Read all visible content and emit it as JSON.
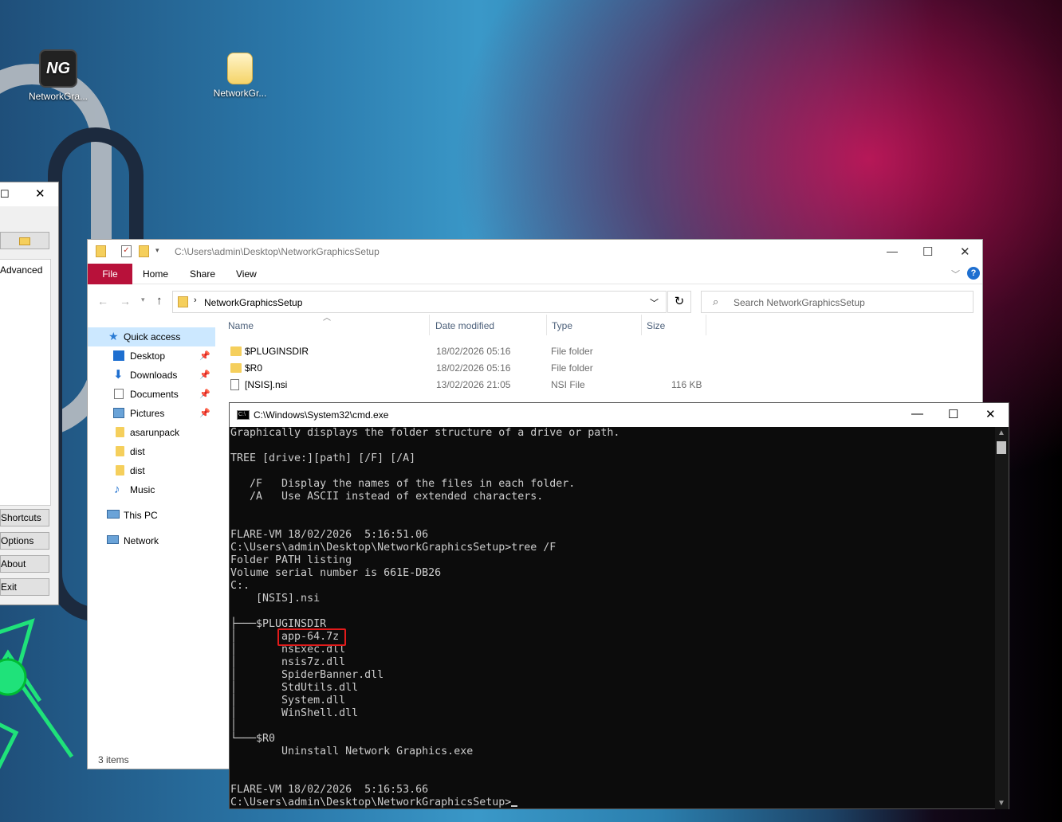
{
  "desktop": {
    "icons": [
      {
        "label": "NetworkGra...",
        "glyph": "NG"
      },
      {
        "label": "NetworkGr..."
      }
    ]
  },
  "left_window": {
    "tab_label": "Advanced",
    "buttons": [
      "Shortcuts",
      "Options",
      "About",
      "Exit"
    ]
  },
  "explorer": {
    "title_path": "C:\\Users\\admin\\Desktop\\NetworkGraphicsSetup",
    "ribbon": {
      "file": "File",
      "home": "Home",
      "share": "Share",
      "view": "View"
    },
    "address": "NetworkGraphicsSetup",
    "search_placeholder": "Search NetworkGraphicsSetup",
    "sidebar": [
      {
        "label": "Quick access",
        "icon": "star-icon"
      },
      {
        "label": "Desktop",
        "icon": "desktop-icon",
        "pinned": true
      },
      {
        "label": "Downloads",
        "icon": "download-icon",
        "pinned": true
      },
      {
        "label": "Documents",
        "icon": "document-icon",
        "pinned": true
      },
      {
        "label": "Pictures",
        "icon": "pictures-icon",
        "pinned": true
      },
      {
        "label": "asarunpack",
        "icon": "folder-icon"
      },
      {
        "label": "dist",
        "icon": "folder-icon"
      },
      {
        "label": "dist",
        "icon": "folder-icon"
      },
      {
        "label": "Music",
        "icon": "music-icon"
      },
      {
        "label": "This PC",
        "icon": "pc-icon"
      },
      {
        "label": "Network",
        "icon": "network-icon"
      }
    ],
    "columns": [
      "Name",
      "Date modified",
      "Type",
      "Size"
    ],
    "files": [
      {
        "name": "$PLUGINSDIR",
        "date": "18/02/2026 05:16",
        "type": "File folder",
        "size": ""
      },
      {
        "name": "$R0",
        "date": "18/02/2026 05:16",
        "type": "File folder",
        "size": ""
      },
      {
        "name": "[NSIS].nsi",
        "date": "13/02/2026 21:05",
        "type": "NSI File",
        "size": "116 KB"
      }
    ],
    "status": "3 items"
  },
  "cmd": {
    "title": "C:\\Windows\\System32\\cmd.exe",
    "icon_text": "C:\\",
    "lines": [
      "Graphically displays the folder structure of a drive or path.",
      "",
      "TREE [drive:][path] [/F] [/A]",
      "",
      "   /F   Display the names of the files in each folder.",
      "   /A   Use ASCII instead of extended characters.",
      "",
      "",
      "FLARE-VM 18/02/2026  5:16:51.06",
      "C:\\Users\\admin\\Desktop\\NetworkGraphicsSetup>tree /F",
      "Folder PATH listing",
      "Volume serial number is 661E-DB26",
      "C:.",
      "    [NSIS].nsi",
      "",
      "├───$PLUGINSDIR",
      "│       app-64.7z",
      "│       nsExec.dll",
      "│       nsis7z.dll",
      "│       SpiderBanner.dll",
      "│       StdUtils.dll",
      "│       System.dll",
      "│       WinShell.dll",
      "│",
      "└───$R0",
      "        Uninstall Network Graphics.exe",
      "",
      "",
      "FLARE-VM 18/02/2026  5:16:53.66",
      "C:\\Users\\admin\\Desktop\\NetworkGraphicsSetup>"
    ]
  }
}
